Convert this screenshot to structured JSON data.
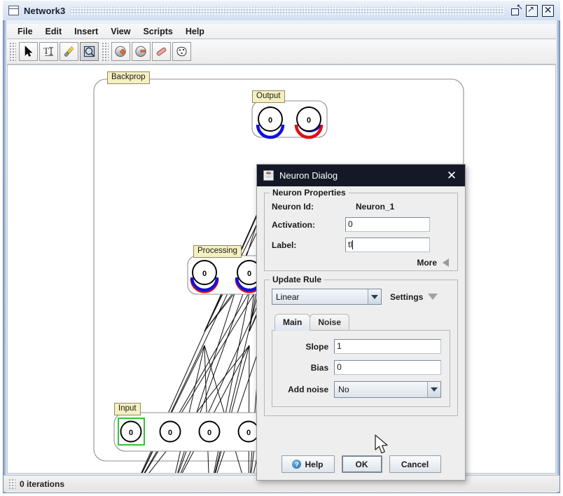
{
  "window": {
    "title": "Network3",
    "icon": "window-icon",
    "controls": [
      {
        "name": "restore-button",
        "glyph": "restore"
      },
      {
        "name": "maximize-button",
        "glyph": "maximize"
      },
      {
        "name": "close-button",
        "glyph": "close"
      }
    ]
  },
  "menubar": {
    "items": [
      "File",
      "Edit",
      "Insert",
      "View",
      "Scripts",
      "Help"
    ]
  },
  "toolbar": {
    "group1": [
      {
        "name": "select-arrow-tool",
        "icon": "cursor-arrow-icon",
        "active": false
      },
      {
        "name": "text-tool",
        "icon": "text-tool-icon",
        "active": false
      },
      {
        "name": "wand-tool",
        "icon": "magic-wand-icon",
        "active": false
      },
      {
        "name": "zoom-tool",
        "icon": "zoom-icon",
        "active": true
      }
    ],
    "group2": [
      {
        "name": "add-neuron-button",
        "icon": "add-neuron-icon",
        "active": false
      },
      {
        "name": "remove-neuron-button",
        "icon": "remove-neuron-icon",
        "active": false
      },
      {
        "name": "eraser-button",
        "icon": "eraser-icon",
        "active": false
      },
      {
        "name": "random-button",
        "icon": "dice-icon",
        "active": false
      }
    ]
  },
  "canvas": {
    "groups": [
      {
        "name": "backprop-group-label",
        "label": "Backprop"
      },
      {
        "name": "output-group-label",
        "label": "Output"
      },
      {
        "name": "processing-group-label",
        "label": "Processing"
      },
      {
        "name": "input-group-label",
        "label": "Input"
      }
    ],
    "layers": {
      "output": {
        "label": "Output",
        "neurons": [
          {
            "value": "0"
          },
          {
            "value": "0"
          }
        ]
      },
      "processing": {
        "label": "Processing",
        "neurons": [
          {
            "value": "0"
          },
          {
            "value": "0"
          }
        ]
      },
      "input": {
        "label": "Input",
        "neurons": [
          {
            "value": "0",
            "selected": true
          },
          {
            "value": "0"
          },
          {
            "value": "0"
          },
          {
            "value": "0"
          }
        ]
      }
    },
    "colors": {
      "selection": "#36c13b",
      "arc_blue": "#1111dd",
      "arc_red": "#dd1111",
      "node_stroke": "#000000",
      "group_label_bg": "#f5f0c0"
    }
  },
  "statusbar": {
    "text": "0 iterations"
  },
  "dialog": {
    "title": "Neuron Dialog",
    "icon": "java-coffee-icon",
    "close_label": "✕",
    "properties": {
      "title": "Neuron Properties",
      "neuron_id_label": "Neuron Id:",
      "neuron_id_value": "Neuron_1",
      "activation_label": "Activation:",
      "activation_value": "0",
      "label_label": "Label:",
      "label_value": "tl",
      "more_label": "More"
    },
    "update_rule": {
      "title": "Update Rule",
      "selected_rule": "Linear",
      "settings_label": "Settings",
      "tabs": [
        {
          "label": "Main",
          "active": true
        },
        {
          "label": "Noise",
          "active": false
        }
      ],
      "fields": [
        {
          "label": "Slope",
          "value": "1"
        },
        {
          "label": "Bias",
          "value": "0"
        }
      ],
      "noise_label": "Add noise",
      "noise_value": "No"
    },
    "buttons": [
      {
        "name": "help-button",
        "label": "Help",
        "icon": "help-icon",
        "focused": false
      },
      {
        "name": "ok-button",
        "label": "OK",
        "focused": true
      },
      {
        "name": "cancel-button",
        "label": "Cancel",
        "focused": false
      }
    ]
  }
}
